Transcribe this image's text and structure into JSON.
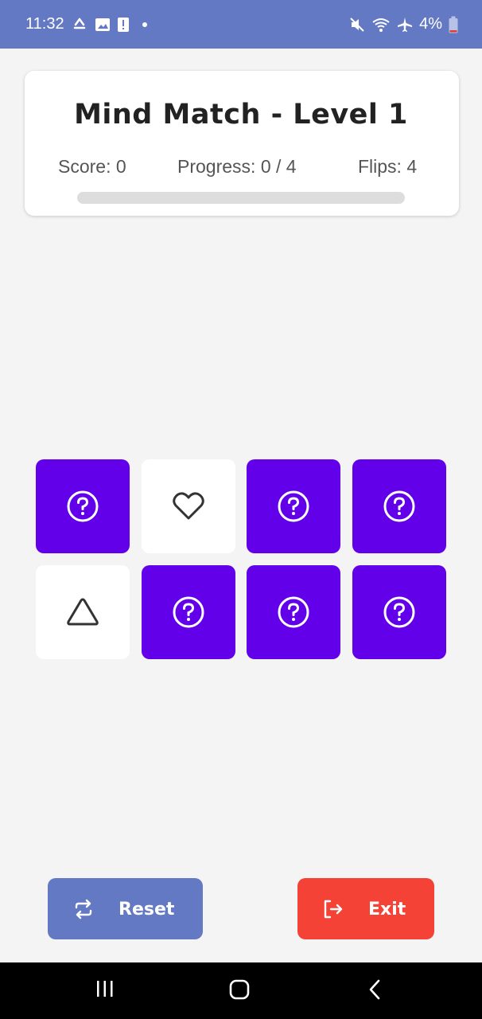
{
  "status_bar": {
    "time": "11:32",
    "battery_text": "4%",
    "icons": [
      "sync-icon",
      "image-icon",
      "alert-icon",
      "dot-icon",
      "mute-icon",
      "wifi-icon",
      "airplane-icon",
      "battery-icon"
    ]
  },
  "header": {
    "title": "Mind Match - Level 1",
    "score_text": "Score: 0",
    "progress_text": "Progress: 0 / 4",
    "flips_text": "Flips: 4",
    "progress_fraction": 0
  },
  "board": {
    "cards": [
      {
        "state": "face-down",
        "icon": "question-icon"
      },
      {
        "state": "face-up",
        "icon": "heart-icon"
      },
      {
        "state": "face-down",
        "icon": "question-icon"
      },
      {
        "state": "face-down",
        "icon": "question-icon"
      },
      {
        "state": "face-up",
        "icon": "triangle-icon"
      },
      {
        "state": "face-down",
        "icon": "question-icon"
      },
      {
        "state": "face-down",
        "icon": "question-icon"
      },
      {
        "state": "face-down",
        "icon": "question-icon"
      }
    ]
  },
  "buttons": {
    "reset_label": "Reset",
    "exit_label": "Exit"
  },
  "nav": {
    "icons": [
      "recent-apps-icon",
      "home-icon",
      "back-icon"
    ]
  },
  "colors": {
    "primary": "#6479c3",
    "card_back": "#6200ea",
    "card_face": "#ffffff",
    "exit": "#f44336",
    "background": "#f4f4f4"
  }
}
